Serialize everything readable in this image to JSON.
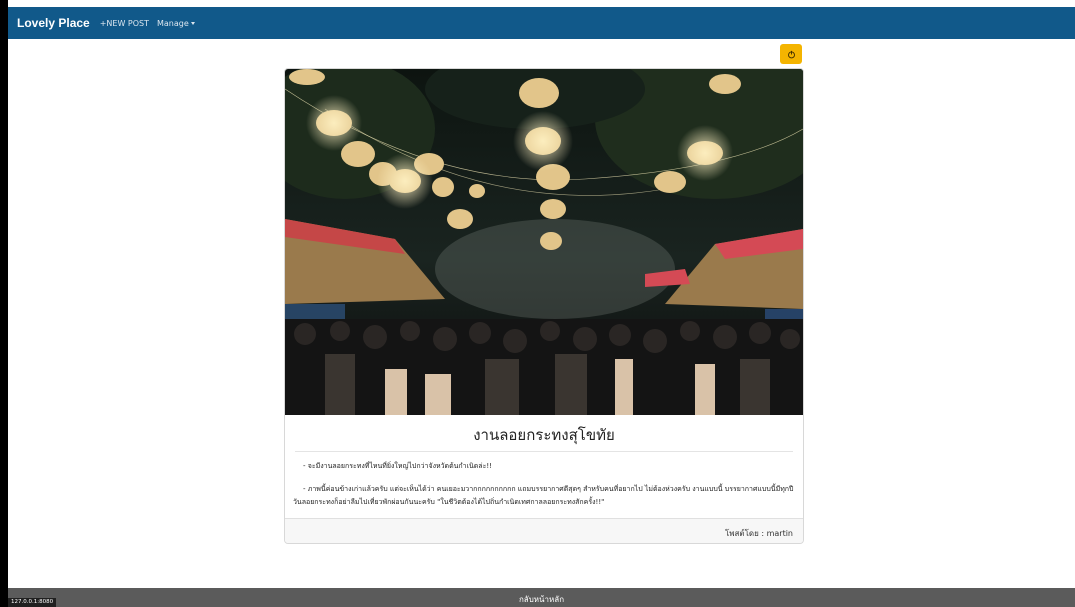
{
  "navbar": {
    "brand": "Lovely Place",
    "links": [
      {
        "label": "+NEW POST"
      },
      {
        "label": "Manage"
      }
    ]
  },
  "action_button": {
    "icon": "power-icon",
    "color": "#f4b400"
  },
  "post": {
    "title": "งานลอยกระทงสุโขทัย",
    "paragraphs": [
      "- จะมีงานลอยกระทงที่ไหนที่ยิ่งใหญ่ไปกว่าจังหวัดต้นกำเนิดล่ะ!!",
      "- ภาพนี้ค่อนข้างเก่าแล้วครับ แต่จะเห็นได้ว่า คนเยอะมวากกกกกกกกกก แถมบรรยากาศดีสุดๆ สำหรับคนที่อยากไป ไม่ต้องห่วงครับ งานแบบนี้ บรรยากาศแบบนี้มีทุกปี วันลอยกระทงก็อย่าลืมไปเที่ยวพักผ่อนกันนะครับ \"ในชีวิตต้องได้ไปถิ่นกำเนิดเทศกาลลอยกระทงสักครั้ง!!\""
    ],
    "author_line": "โพสต์โดย : martin"
  },
  "footer": {
    "link_label": "กลับหน้าหลัก"
  },
  "status_bar": {
    "url": "127.0.0.1:8080"
  },
  "colors": {
    "navbar": "#11598a",
    "footer": "#5b5b5b",
    "accent": "#f4b400"
  }
}
